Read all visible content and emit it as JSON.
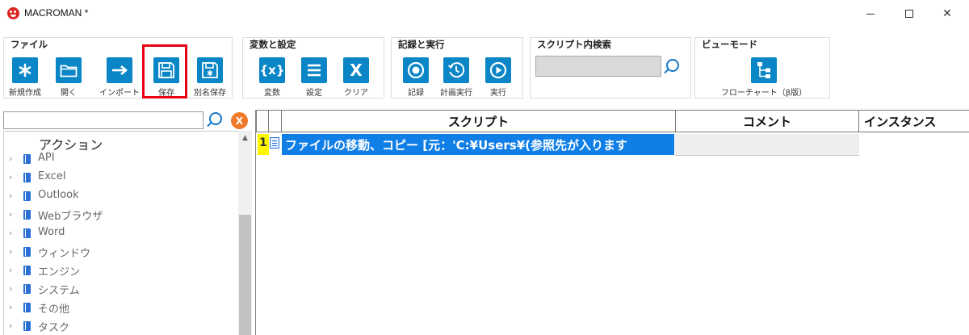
{
  "window": {
    "title": "MACROMAN *",
    "minimize": "—",
    "maximize": "☐",
    "close": "✕"
  },
  "ribbon": {
    "file": {
      "title": "ファイル",
      "buttons": [
        "新規作成",
        "開く",
        "インポート",
        "保存",
        "別名保存"
      ]
    },
    "vars": {
      "title": "変数と設定",
      "buttons": [
        "変数",
        "設定",
        "クリア"
      ]
    },
    "record": {
      "title": "記録と実行",
      "buttons": [
        "記録",
        "計画実行",
        "実行"
      ]
    },
    "search": {
      "title": "スクリプト内検索",
      "value": ""
    },
    "view": {
      "title": "ビューモード",
      "buttons": [
        "フローチャート（β版）"
      ]
    }
  },
  "left_panel": {
    "search_value": "",
    "clear_label": "X",
    "tree_title": "アクション",
    "items": [
      "API",
      "Excel",
      "Outlook",
      "Webブラウザ",
      "Word",
      "ウィンドウ",
      "エンジン",
      "システム",
      "その他",
      "タスク"
    ]
  },
  "grid": {
    "columns": [
      "スクリプト",
      "コメント",
      "インスタンス"
    ],
    "rows": [
      {
        "num": "1",
        "script": "ファイルの移動、コピー [元：'C:¥Users¥(参照先が入ります",
        "comment": "",
        "instance": ""
      }
    ]
  },
  "colors": {
    "accent": "#0a86c6",
    "highlight": "#e60012",
    "selection": "#0f7ee6",
    "row_number": "#fff700"
  }
}
